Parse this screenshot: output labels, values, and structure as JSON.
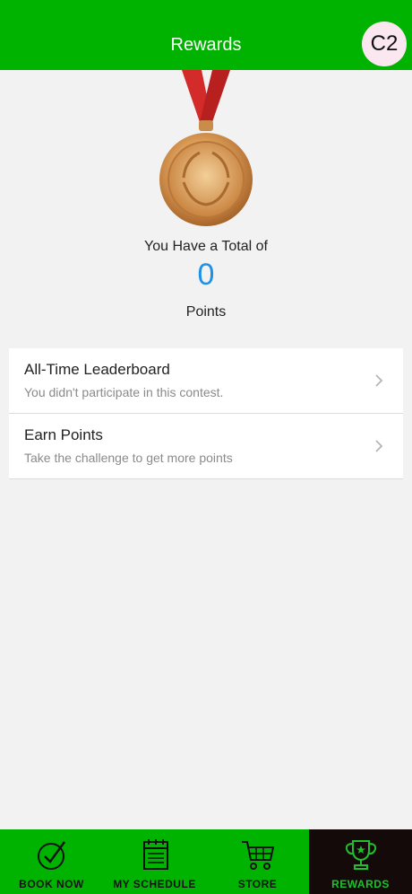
{
  "header": {
    "title": "Rewards",
    "avatar_text": "C2"
  },
  "rewards": {
    "total_label": "You Have a Total of",
    "points_value": "0",
    "points_label": "Points"
  },
  "list": {
    "items": [
      {
        "title": "All-Time Leaderboard",
        "subtitle": "You didn't participate in this contest."
      },
      {
        "title": "Earn Points",
        "subtitle": "Take the challenge to get more points"
      }
    ]
  },
  "tabbar": {
    "tabs": [
      {
        "label": "BOOK NOW",
        "icon": "check-circle-icon"
      },
      {
        "label": "MY SCHEDULE",
        "icon": "calendar-icon"
      },
      {
        "label": "STORE",
        "icon": "cart-icon"
      },
      {
        "label": "REWARDS",
        "icon": "trophy-icon",
        "active": true
      }
    ]
  },
  "colors": {
    "brand_green": "#00b300",
    "points_blue": "#1e90e6",
    "active_tab_bg": "#150a0a",
    "active_tab_text": "#1fbf2f"
  }
}
